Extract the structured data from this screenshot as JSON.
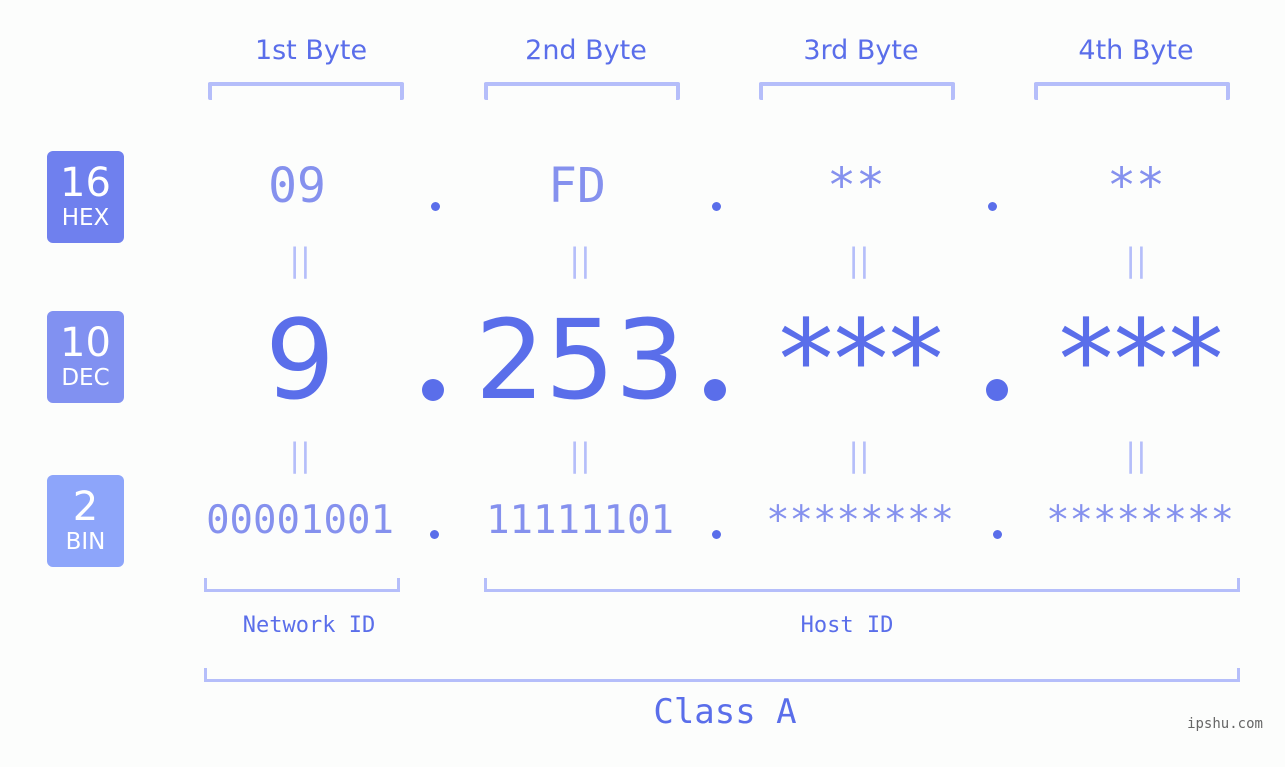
{
  "bases": [
    {
      "number": "16",
      "label": "HEX",
      "color": "#6f80ee"
    },
    {
      "number": "10",
      "label": "DEC",
      "color": "#8191f1"
    },
    {
      "number": "2",
      "label": "BIN",
      "color": "#8da5fa"
    }
  ],
  "byte_headers": [
    "1st Byte",
    "2nd Byte",
    "3rd Byte",
    "4th Byte"
  ],
  "hex_values": [
    "09",
    "FD",
    "**",
    "**"
  ],
  "dec_values": [
    "9",
    "253",
    "***",
    "***"
  ],
  "bin_values": [
    "00001001",
    "11111101",
    "********",
    "********"
  ],
  "separator": ".",
  "equals_sign": "||",
  "network_id_label": "Network ID",
  "host_id_label": "Host ID",
  "class_label": "Class A",
  "watermark": "ipshu.com",
  "colors": {
    "accent": "#5a6eea",
    "light_accent": "#8591ee",
    "bracket": "#b5befa",
    "background": "#fcfdfc"
  }
}
